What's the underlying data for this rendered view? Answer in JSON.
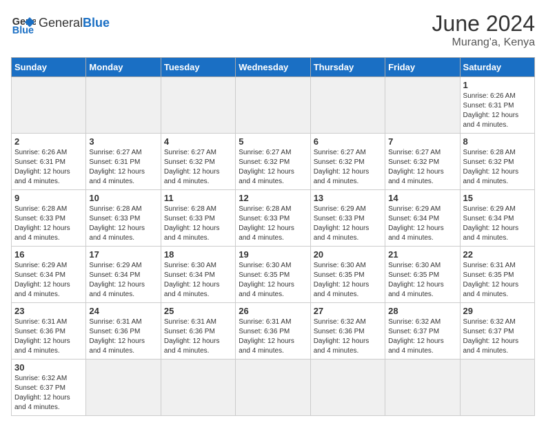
{
  "header": {
    "logo_general": "General",
    "logo_blue": "Blue",
    "month": "June 2024",
    "location": "Murang'a, Kenya"
  },
  "weekdays": [
    "Sunday",
    "Monday",
    "Tuesday",
    "Wednesday",
    "Thursday",
    "Friday",
    "Saturday"
  ],
  "weeks": [
    [
      {
        "day": "",
        "info": ""
      },
      {
        "day": "",
        "info": ""
      },
      {
        "day": "",
        "info": ""
      },
      {
        "day": "",
        "info": ""
      },
      {
        "day": "",
        "info": ""
      },
      {
        "day": "",
        "info": ""
      },
      {
        "day": "1",
        "info": "Sunrise: 6:26 AM\nSunset: 6:31 PM\nDaylight: 12 hours and 4 minutes."
      }
    ],
    [
      {
        "day": "2",
        "info": "Sunrise: 6:26 AM\nSunset: 6:31 PM\nDaylight: 12 hours and 4 minutes."
      },
      {
        "day": "3",
        "info": "Sunrise: 6:27 AM\nSunset: 6:31 PM\nDaylight: 12 hours and 4 minutes."
      },
      {
        "day": "4",
        "info": "Sunrise: 6:27 AM\nSunset: 6:32 PM\nDaylight: 12 hours and 4 minutes."
      },
      {
        "day": "5",
        "info": "Sunrise: 6:27 AM\nSunset: 6:32 PM\nDaylight: 12 hours and 4 minutes."
      },
      {
        "day": "6",
        "info": "Sunrise: 6:27 AM\nSunset: 6:32 PM\nDaylight: 12 hours and 4 minutes."
      },
      {
        "day": "7",
        "info": "Sunrise: 6:27 AM\nSunset: 6:32 PM\nDaylight: 12 hours and 4 minutes."
      },
      {
        "day": "8",
        "info": "Sunrise: 6:28 AM\nSunset: 6:32 PM\nDaylight: 12 hours and 4 minutes."
      }
    ],
    [
      {
        "day": "9",
        "info": "Sunrise: 6:28 AM\nSunset: 6:33 PM\nDaylight: 12 hours and 4 minutes."
      },
      {
        "day": "10",
        "info": "Sunrise: 6:28 AM\nSunset: 6:33 PM\nDaylight: 12 hours and 4 minutes."
      },
      {
        "day": "11",
        "info": "Sunrise: 6:28 AM\nSunset: 6:33 PM\nDaylight: 12 hours and 4 minutes."
      },
      {
        "day": "12",
        "info": "Sunrise: 6:28 AM\nSunset: 6:33 PM\nDaylight: 12 hours and 4 minutes."
      },
      {
        "day": "13",
        "info": "Sunrise: 6:29 AM\nSunset: 6:33 PM\nDaylight: 12 hours and 4 minutes."
      },
      {
        "day": "14",
        "info": "Sunrise: 6:29 AM\nSunset: 6:34 PM\nDaylight: 12 hours and 4 minutes."
      },
      {
        "day": "15",
        "info": "Sunrise: 6:29 AM\nSunset: 6:34 PM\nDaylight: 12 hours and 4 minutes."
      }
    ],
    [
      {
        "day": "16",
        "info": "Sunrise: 6:29 AM\nSunset: 6:34 PM\nDaylight: 12 hours and 4 minutes."
      },
      {
        "day": "17",
        "info": "Sunrise: 6:29 AM\nSunset: 6:34 PM\nDaylight: 12 hours and 4 minutes."
      },
      {
        "day": "18",
        "info": "Sunrise: 6:30 AM\nSunset: 6:34 PM\nDaylight: 12 hours and 4 minutes."
      },
      {
        "day": "19",
        "info": "Sunrise: 6:30 AM\nSunset: 6:35 PM\nDaylight: 12 hours and 4 minutes."
      },
      {
        "day": "20",
        "info": "Sunrise: 6:30 AM\nSunset: 6:35 PM\nDaylight: 12 hours and 4 minutes."
      },
      {
        "day": "21",
        "info": "Sunrise: 6:30 AM\nSunset: 6:35 PM\nDaylight: 12 hours and 4 minutes."
      },
      {
        "day": "22",
        "info": "Sunrise: 6:31 AM\nSunset: 6:35 PM\nDaylight: 12 hours and 4 minutes."
      }
    ],
    [
      {
        "day": "23",
        "info": "Sunrise: 6:31 AM\nSunset: 6:36 PM\nDaylight: 12 hours and 4 minutes."
      },
      {
        "day": "24",
        "info": "Sunrise: 6:31 AM\nSunset: 6:36 PM\nDaylight: 12 hours and 4 minutes."
      },
      {
        "day": "25",
        "info": "Sunrise: 6:31 AM\nSunset: 6:36 PM\nDaylight: 12 hours and 4 minutes."
      },
      {
        "day": "26",
        "info": "Sunrise: 6:31 AM\nSunset: 6:36 PM\nDaylight: 12 hours and 4 minutes."
      },
      {
        "day": "27",
        "info": "Sunrise: 6:32 AM\nSunset: 6:36 PM\nDaylight: 12 hours and 4 minutes."
      },
      {
        "day": "28",
        "info": "Sunrise: 6:32 AM\nSunset: 6:37 PM\nDaylight: 12 hours and 4 minutes."
      },
      {
        "day": "29",
        "info": "Sunrise: 6:32 AM\nSunset: 6:37 PM\nDaylight: 12 hours and 4 minutes."
      }
    ],
    [
      {
        "day": "30",
        "info": "Sunrise: 6:32 AM\nSunset: 6:37 PM\nDaylight: 12 hours and 4 minutes."
      },
      {
        "day": "",
        "info": ""
      },
      {
        "day": "",
        "info": ""
      },
      {
        "day": "",
        "info": ""
      },
      {
        "day": "",
        "info": ""
      },
      {
        "day": "",
        "info": ""
      },
      {
        "day": "",
        "info": ""
      }
    ]
  ]
}
